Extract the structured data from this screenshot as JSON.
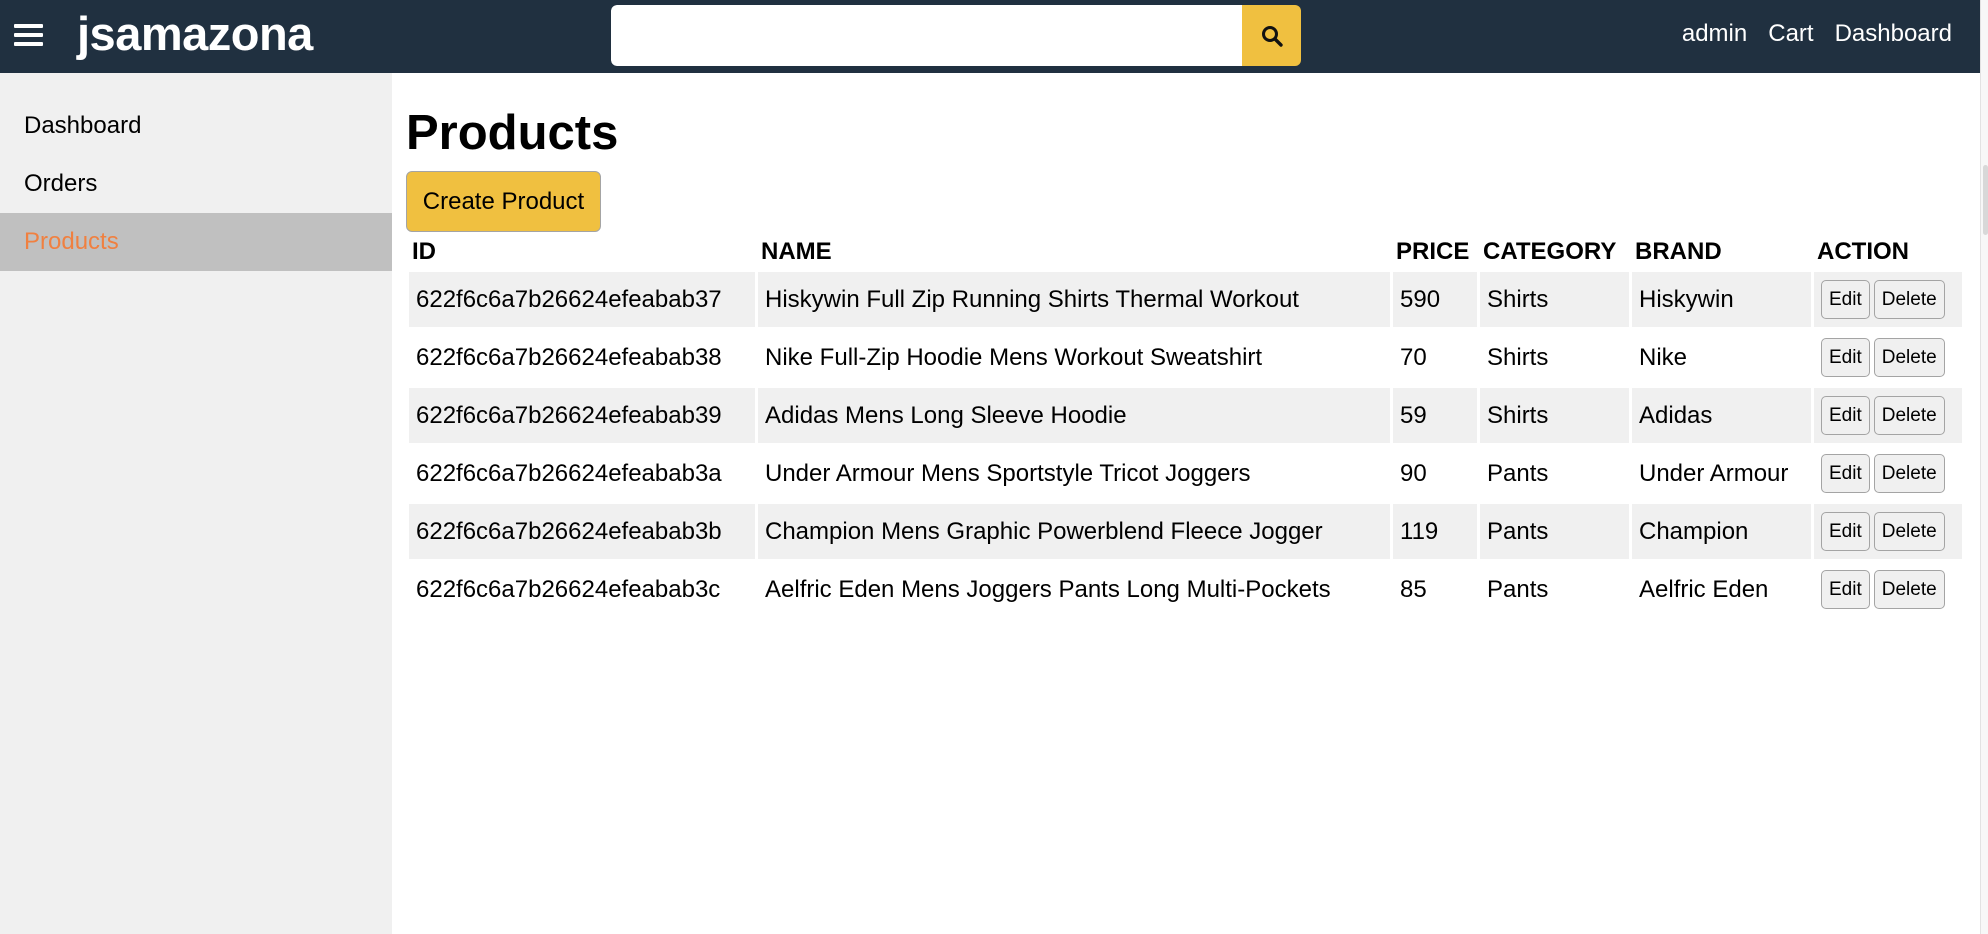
{
  "header": {
    "brand": "jsamazona",
    "search": {
      "value": "",
      "placeholder": ""
    },
    "nav": {
      "admin": "admin",
      "cart": "Cart",
      "dashboard": "Dashboard"
    }
  },
  "sidebar": {
    "items": [
      {
        "label": "Dashboard",
        "active": false
      },
      {
        "label": "Orders",
        "active": false
      },
      {
        "label": "Products",
        "active": true
      }
    ]
  },
  "main": {
    "title": "Products",
    "create_label": "Create Product",
    "columns": [
      "ID",
      "NAME",
      "PRICE",
      "CATEGORY",
      "BRAND",
      "ACTION"
    ],
    "edit_label": "Edit",
    "delete_label": "Delete",
    "rows": [
      {
        "id": "622f6c6a7b26624efeabab37",
        "name": "Hiskywin Full Zip Running Shirts Thermal Workout",
        "price": "590",
        "category": "Shirts",
        "brand": "Hiskywin"
      },
      {
        "id": "622f6c6a7b26624efeabab38",
        "name": "Nike Full-Zip Hoodie Mens Workout Sweatshirt",
        "price": "70",
        "category": "Shirts",
        "brand": "Nike"
      },
      {
        "id": "622f6c6a7b26624efeabab39",
        "name": "Adidas Mens Long Sleeve Hoodie",
        "price": "59",
        "category": "Shirts",
        "brand": "Adidas"
      },
      {
        "id": "622f6c6a7b26624efeabab3a",
        "name": "Under Armour Mens Sportstyle Tricot Joggers",
        "price": "90",
        "category": "Pants",
        "brand": "Under Armour"
      },
      {
        "id": "622f6c6a7b26624efeabab3b",
        "name": "Champion Mens Graphic Powerblend Fleece Jogger",
        "price": "119",
        "category": "Pants",
        "brand": "Champion"
      },
      {
        "id": "622f6c6a7b26624efeabab3c",
        "name": "Aelfric Eden Mens Joggers Pants Long Multi-Pockets",
        "price": "85",
        "category": "Pants",
        "brand": "Aelfric Eden"
      }
    ]
  },
  "colors": {
    "header_bg": "#203040",
    "accent": "#f0c040",
    "active_link": "#f08040",
    "sidebar_bg": "#f0f0f0",
    "sidebar_active_bg": "#c0c0c0"
  },
  "icons": {
    "menu": "hamburger-menu-icon",
    "search": "search-icon"
  }
}
